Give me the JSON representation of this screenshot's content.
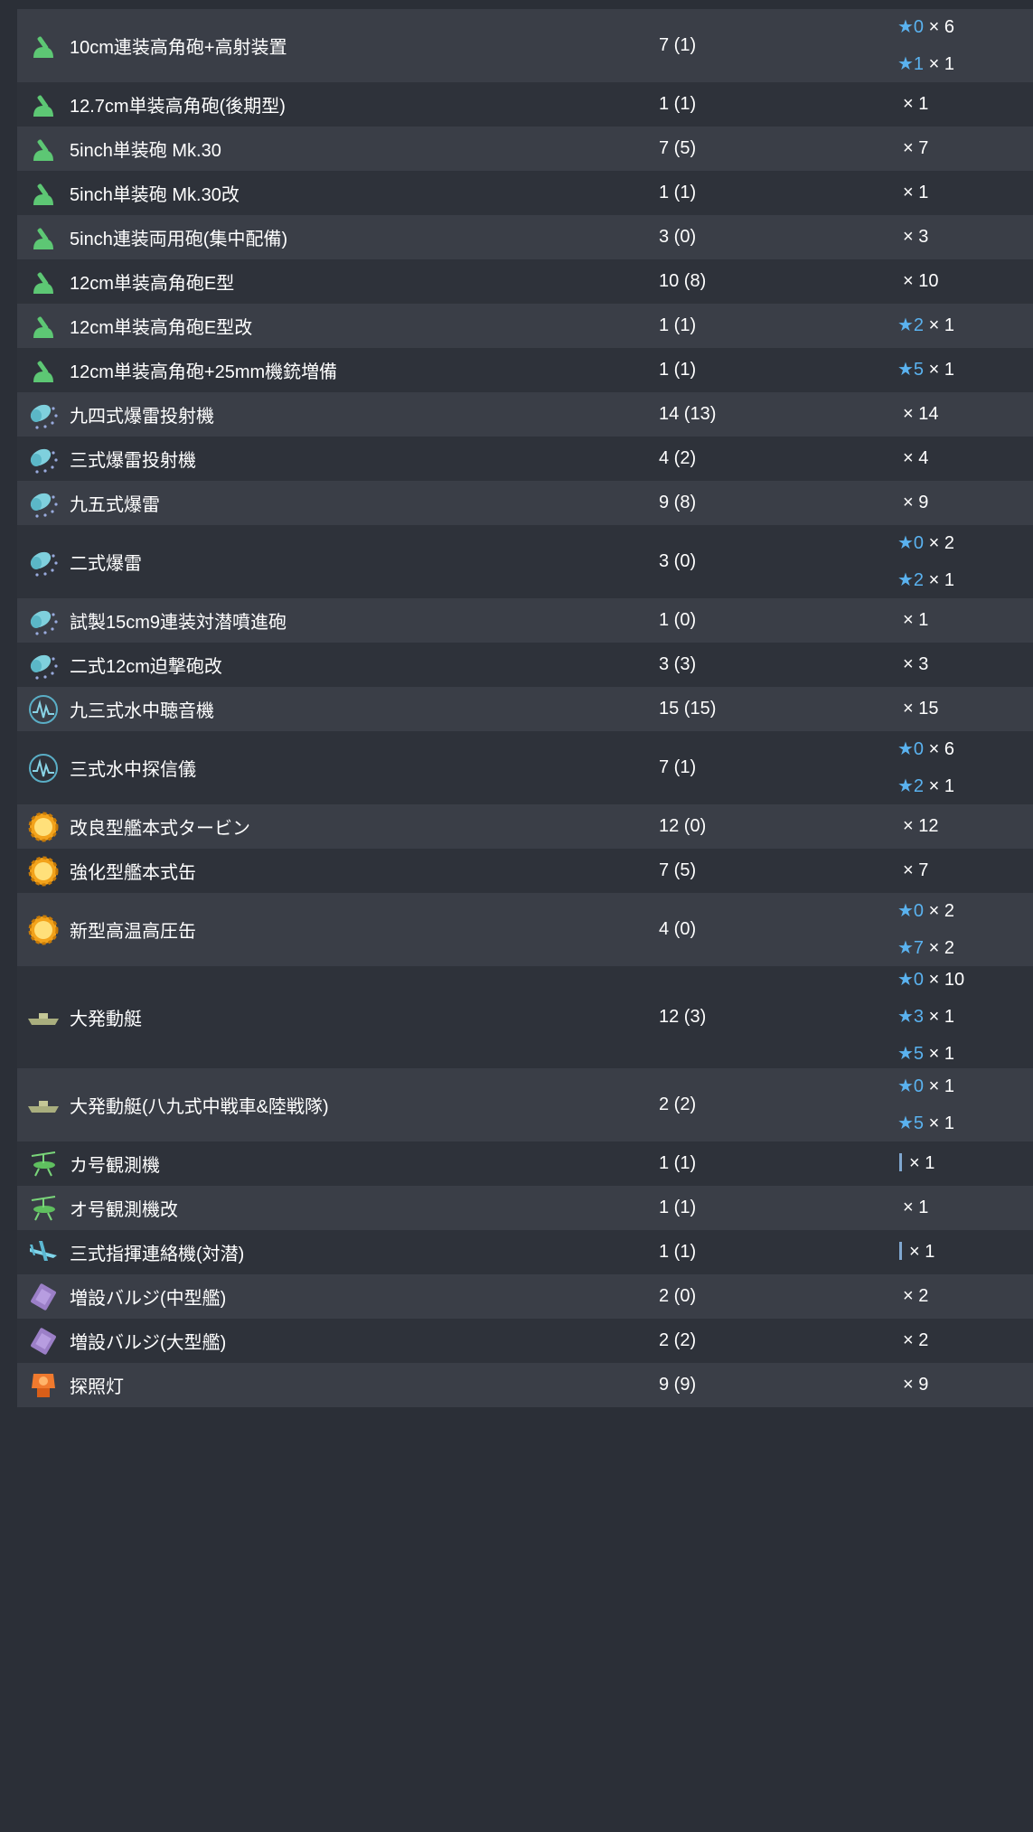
{
  "rows": [
    {
      "icon": "gun-icon",
      "name": "10cm連装高角砲+高射装置",
      "count": "7 (1)",
      "improvements": [
        {
          "star": "★0",
          "qty": "× 6"
        },
        {
          "star": "★1",
          "qty": "× 1"
        }
      ]
    },
    {
      "icon": "gun-icon",
      "name": "12.7cm単装高角砲(後期型)",
      "count": "1 (1)",
      "improvements": [
        {
          "star": "",
          "qty": "× 1"
        }
      ]
    },
    {
      "icon": "gun-icon",
      "name": "5inch単装砲 Mk.30",
      "count": "7 (5)",
      "improvements": [
        {
          "star": "",
          "qty": "× 7"
        }
      ]
    },
    {
      "icon": "gun-icon",
      "name": "5inch単装砲 Mk.30改",
      "count": "1 (1)",
      "improvements": [
        {
          "star": "",
          "qty": "× 1"
        }
      ]
    },
    {
      "icon": "gun-icon",
      "name": "5inch連装両用砲(集中配備)",
      "count": "3 (0)",
      "improvements": [
        {
          "star": "",
          "qty": "× 3"
        }
      ]
    },
    {
      "icon": "gun-icon",
      "name": "12cm単装高角砲E型",
      "count": "10 (8)",
      "improvements": [
        {
          "star": "",
          "qty": "× 10"
        }
      ]
    },
    {
      "icon": "gun-icon",
      "name": "12cm単装高角砲E型改",
      "count": "1 (1)",
      "improvements": [
        {
          "star": "★2",
          "qty": "× 1"
        }
      ]
    },
    {
      "icon": "gun-icon",
      "name": "12cm単装高角砲+25mm機銃増備",
      "count": "1 (1)",
      "improvements": [
        {
          "star": "★5",
          "qty": "× 1"
        }
      ]
    },
    {
      "icon": "depth-charge-icon",
      "name": "九四式爆雷投射機",
      "count": "14 (13)",
      "improvements": [
        {
          "star": "",
          "qty": "× 14"
        }
      ]
    },
    {
      "icon": "depth-charge-icon",
      "name": "三式爆雷投射機",
      "count": "4 (2)",
      "improvements": [
        {
          "star": "",
          "qty": "× 4"
        }
      ]
    },
    {
      "icon": "depth-charge-icon",
      "name": "九五式爆雷",
      "count": "9 (8)",
      "improvements": [
        {
          "star": "",
          "qty": "× 9"
        }
      ]
    },
    {
      "icon": "depth-charge-icon",
      "name": "二式爆雷",
      "count": "3 (0)",
      "improvements": [
        {
          "star": "★0",
          "qty": "× 2"
        },
        {
          "star": "★2",
          "qty": "× 1"
        }
      ]
    },
    {
      "icon": "depth-charge-icon",
      "name": "試製15cm9連装対潜噴進砲",
      "count": "1 (0)",
      "improvements": [
        {
          "star": "",
          "qty": "× 1"
        }
      ]
    },
    {
      "icon": "depth-charge-icon",
      "name": "二式12cm迫撃砲改",
      "count": "3 (3)",
      "improvements": [
        {
          "star": "",
          "qty": "× 3"
        }
      ]
    },
    {
      "icon": "sonar-icon",
      "name": "九三式水中聴音機",
      "count": "15 (15)",
      "improvements": [
        {
          "star": "",
          "qty": "× 15"
        }
      ]
    },
    {
      "icon": "sonar-icon",
      "name": "三式水中探信儀",
      "count": "7 (1)",
      "improvements": [
        {
          "star": "★0",
          "qty": "× 6"
        },
        {
          "star": "★2",
          "qty": "× 1"
        }
      ]
    },
    {
      "icon": "engine-icon",
      "name": "改良型艦本式タービン",
      "count": "12 (0)",
      "improvements": [
        {
          "star": "",
          "qty": "× 12"
        }
      ]
    },
    {
      "icon": "engine-icon",
      "name": "強化型艦本式缶",
      "count": "7 (5)",
      "improvements": [
        {
          "star": "",
          "qty": "× 7"
        }
      ]
    },
    {
      "icon": "engine-icon",
      "name": "新型高温高圧缶",
      "count": "4 (0)",
      "improvements": [
        {
          "star": "★0",
          "qty": "× 2"
        },
        {
          "star": "★7",
          "qty": "× 2"
        }
      ]
    },
    {
      "icon": "landing-craft-icon",
      "name": "大発動艇",
      "count": "12 (3)",
      "improvements": [
        {
          "star": "★0",
          "qty": "× 10"
        },
        {
          "star": "★3",
          "qty": "× 1"
        },
        {
          "star": "★5",
          "qty": "× 1"
        }
      ]
    },
    {
      "icon": "landing-craft-icon",
      "name": "大発動艇(八九式中戦車&陸戦隊)",
      "count": "2 (2)",
      "improvements": [
        {
          "star": "★0",
          "qty": "× 1"
        },
        {
          "star": "★5",
          "qty": "× 1"
        }
      ]
    },
    {
      "icon": "autogyro-icon",
      "name": "カ号観測機",
      "count": "1 (1)",
      "improvements": [
        {
          "star": "",
          "qty": "× 1",
          "mark": true
        }
      ]
    },
    {
      "icon": "autogyro-icon",
      "name": "オ号観測機改",
      "count": "1 (1)",
      "improvements": [
        {
          "star": "",
          "qty": "× 1"
        }
      ]
    },
    {
      "icon": "liaison-plane-icon",
      "name": "三式指揮連絡機(対潜)",
      "count": "1 (1)",
      "improvements": [
        {
          "star": "",
          "qty": "× 1",
          "mark": true
        }
      ]
    },
    {
      "icon": "bulge-icon",
      "name": "増設バルジ(中型艦)",
      "count": "2 (0)",
      "improvements": [
        {
          "star": "",
          "qty": "× 2"
        }
      ]
    },
    {
      "icon": "bulge-icon",
      "name": "増設バルジ(大型艦)",
      "count": "2 (2)",
      "improvements": [
        {
          "star": "",
          "qty": "× 2"
        }
      ]
    },
    {
      "icon": "searchlight-icon",
      "name": "探照灯",
      "count": "9 (9)",
      "improvements": [
        {
          "star": "",
          "qty": "× 9"
        }
      ]
    }
  ]
}
